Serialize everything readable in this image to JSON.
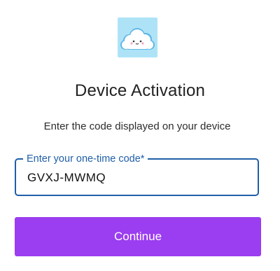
{
  "logo": {
    "icon": "cloud-icon",
    "background_color": "#aee3f7",
    "cloud_color": "#ffffff"
  },
  "title": "Device Activation",
  "subtitle": "Enter the code displayed on your device",
  "code_field": {
    "label": "Enter your one-time code*",
    "value": "GVXJ-MWMQ",
    "border_color": "#1f5fa8"
  },
  "continue_button": {
    "label": "Continue",
    "color": "#9b3df0"
  }
}
